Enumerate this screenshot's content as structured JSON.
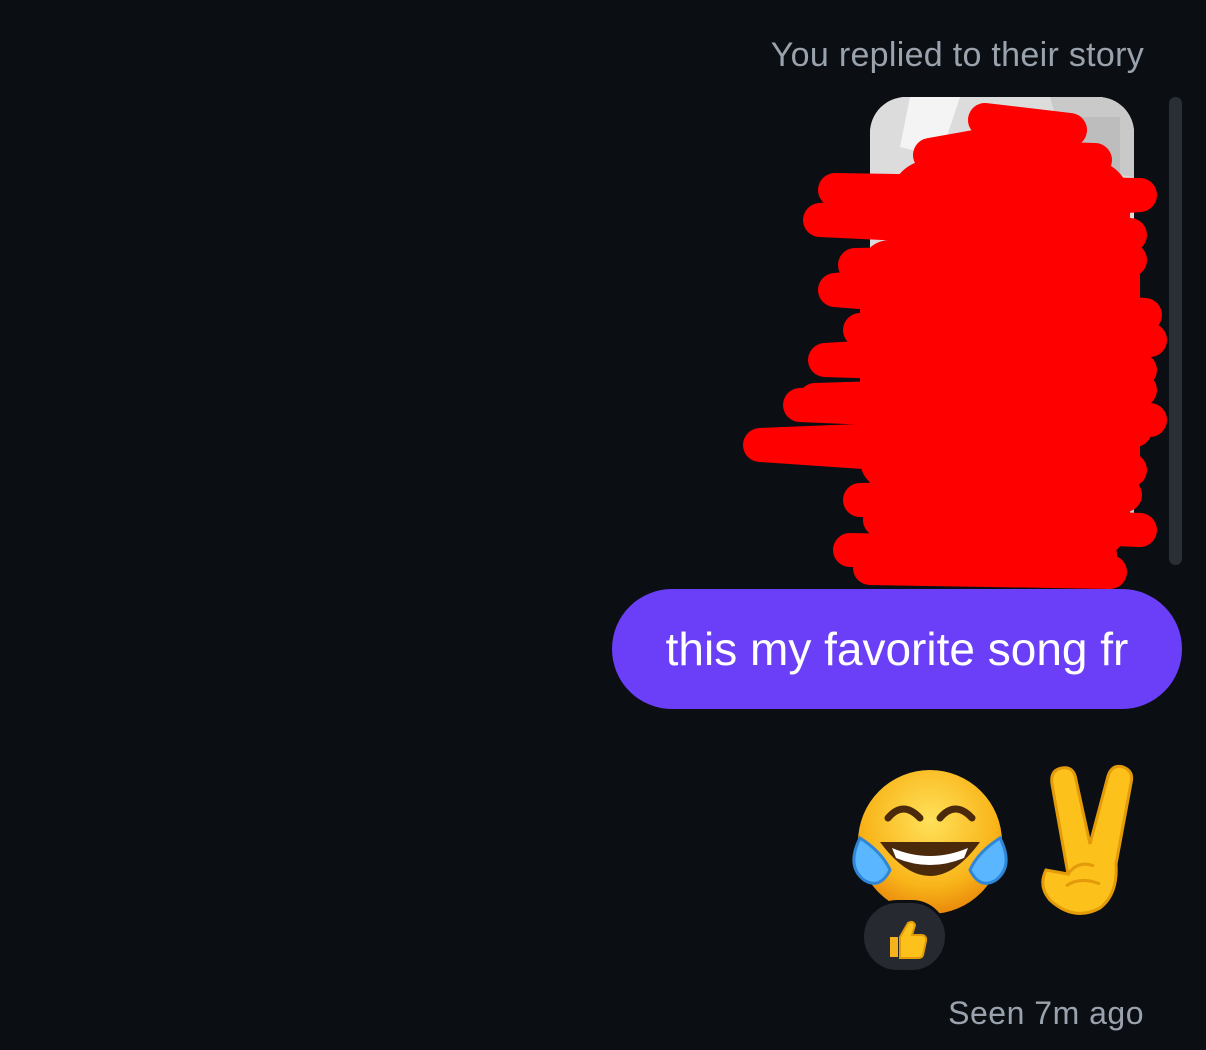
{
  "thread": {
    "story_reply": {
      "caption": "You replied to their story",
      "thumbnail_icon": "story-thumbnail-redacted"
    },
    "message": {
      "text": "this my favorite song fr",
      "bubble_color": "#6a3ff7"
    },
    "emoji_message": {
      "icons": [
        "face-with-tears-of-joy-icon",
        "victory-hand-icon"
      ],
      "reaction_icon": "thumbs-up-icon"
    },
    "status": "Seen 7m ago"
  },
  "colors": {
    "background": "#0b0f14",
    "caption_text": "#9aa3ad",
    "redaction": "#ff0000",
    "reaction_chip": "#262a30"
  }
}
